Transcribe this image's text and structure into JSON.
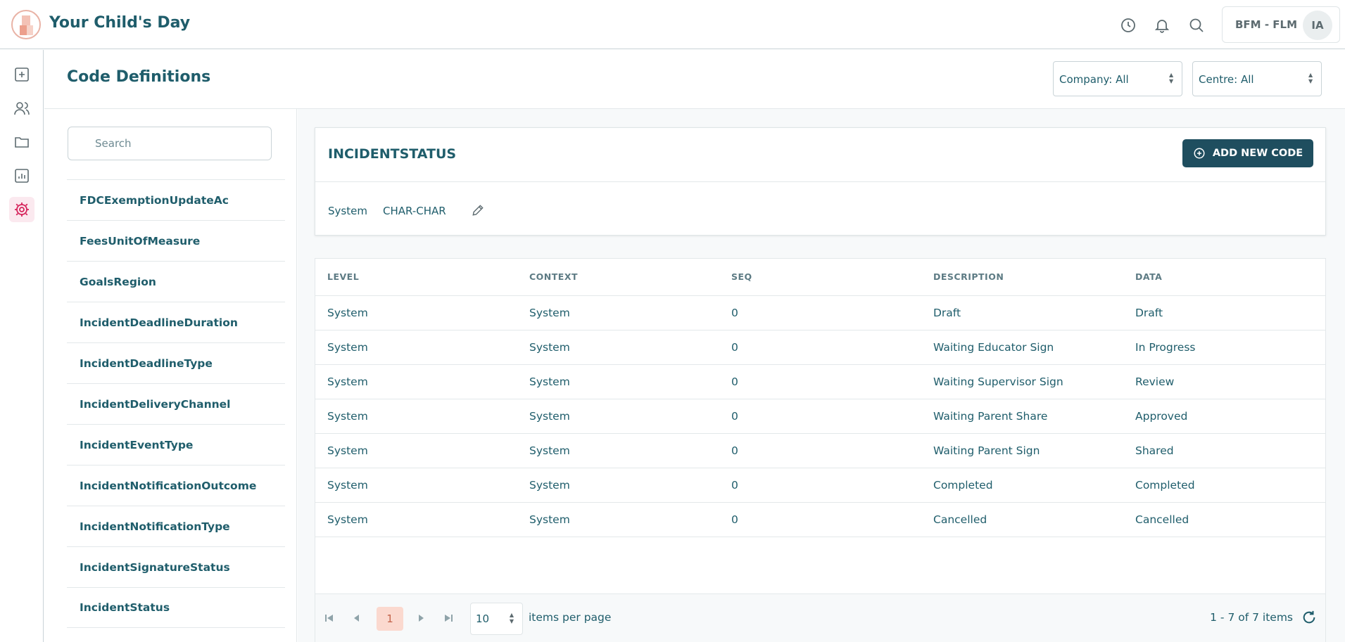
{
  "app": {
    "title": "Your Child's Day"
  },
  "topbar": {
    "icons": [
      "clock-icon",
      "bell-icon",
      "search-icon"
    ],
    "user_label": "BFM - FLM",
    "avatar_initials": "IA"
  },
  "rail": {
    "items": [
      {
        "icon": "add-square-icon",
        "active": false
      },
      {
        "icon": "users-icon",
        "active": false
      },
      {
        "icon": "folder-icon",
        "active": false
      },
      {
        "icon": "report-chart-icon",
        "active": false
      },
      {
        "icon": "settings-gear-icon",
        "active": true
      }
    ],
    "active_color": "#d6245c"
  },
  "page": {
    "title": "Code Definitions",
    "company_filter": "Company: All",
    "centre_filter": "Centre: All"
  },
  "codes": {
    "search_placeholder": "Search",
    "items": [
      "FDCExemptionUpdateAc",
      "FeesUnitOfMeasure",
      "GoalsRegion",
      "IncidentDeadlineDuration",
      "IncidentDeadlineType",
      "IncidentDeliveryChannel",
      "IncidentEventType",
      "IncidentNotificationOutcome",
      "IncidentNotificationType",
      "IncidentSignatureStatus",
      "IncidentStatus"
    ]
  },
  "detail": {
    "title": "INCIDENTSTATUS",
    "add_button": "ADD NEW CODE",
    "level": "System",
    "type": "CHAR-CHAR"
  },
  "table": {
    "headers": [
      "LEVEL",
      "CONTEXT",
      "SEQ",
      "DESCRIPTION",
      "DATA"
    ],
    "rows": [
      [
        "System",
        "System",
        "0",
        "Draft",
        "Draft"
      ],
      [
        "System",
        "System",
        "0",
        "Waiting Educator Sign",
        "In Progress"
      ],
      [
        "System",
        "System",
        "0",
        "Waiting Supervisor Sign",
        "Review"
      ],
      [
        "System",
        "System",
        "0",
        "Waiting Parent Share",
        "Approved"
      ],
      [
        "System",
        "System",
        "0",
        "Waiting Parent Sign",
        "Shared"
      ],
      [
        "System",
        "System",
        "0",
        "Completed",
        "Completed"
      ],
      [
        "System",
        "System",
        "0",
        "Cancelled",
        "Cancelled"
      ]
    ]
  },
  "pager": {
    "current_page": "1",
    "page_size": "10",
    "page_size_label": "items per page",
    "count_label": "1 - 7 of 7 items"
  },
  "colors": {
    "primary": "#1f5d6b",
    "button": "#1f4e5f",
    "accent": "#d6245c",
    "page_highlight": "#fbd9cf"
  }
}
